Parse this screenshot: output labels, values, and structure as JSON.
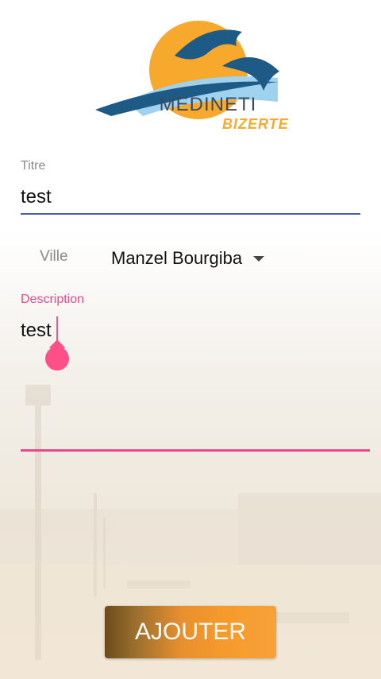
{
  "logo": {
    "title": "MEDINETI",
    "subtitle": "BIZERTE",
    "colors": {
      "sun": "#f6a92c",
      "dolphin": "#1e5a86",
      "wave": "#9fd2ef"
    }
  },
  "form": {
    "titre": {
      "label": "Titre",
      "value": "test"
    },
    "ville": {
      "label": "Ville",
      "selected": "Manzel Bourgiba"
    },
    "description": {
      "label": "Description",
      "value": "test"
    }
  },
  "actions": {
    "submit_label": "AJOUTER"
  },
  "colors": {
    "accent_pink": "#e64a8a",
    "underline_blue": "#4b5aa9",
    "button_orange": "#f59a2c"
  }
}
